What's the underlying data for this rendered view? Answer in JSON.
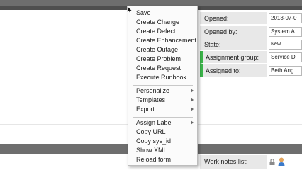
{
  "context_menu": {
    "items": [
      {
        "label": "Save",
        "submenu": false
      },
      {
        "label": "Create Change",
        "submenu": false
      },
      {
        "label": "Create Defect",
        "submenu": false
      },
      {
        "label": "Create Enhancement",
        "submenu": false
      },
      {
        "label": "Create Outage",
        "submenu": false
      },
      {
        "label": "Create Problem",
        "submenu": false
      },
      {
        "label": "Create Request",
        "submenu": false
      },
      {
        "label": "Execute Runbook",
        "submenu": false
      },
      {
        "label": "Personalize",
        "submenu": true
      },
      {
        "label": "Templates",
        "submenu": true
      },
      {
        "label": "Export",
        "submenu": true
      },
      {
        "label": "Assign Label",
        "submenu": true
      },
      {
        "label": "Copy URL",
        "submenu": false
      },
      {
        "label": "Copy sys_id",
        "submenu": false
      },
      {
        "label": "Show XML",
        "submenu": false
      },
      {
        "label": "Reload form",
        "submenu": false
      }
    ]
  },
  "form": {
    "fields": [
      {
        "label": "Opened:",
        "value": "2013-07-0",
        "mandatory": false
      },
      {
        "label": "Opened by:",
        "value": "System A",
        "mandatory": false
      },
      {
        "label": "State:",
        "value": "New",
        "mandatory": false
      },
      {
        "label": "Assignment group:",
        "value": "Service D",
        "mandatory": true
      },
      {
        "label": "Assigned to:",
        "value": "Beth Ang",
        "mandatory": true
      }
    ],
    "work_notes_label": "Work notes list:"
  },
  "icons": {
    "cursor": "mouse-pointer-icon",
    "lock": "lock-icon",
    "user": "user-icon",
    "submenu_arrow": "chevron-right-icon"
  },
  "colors": {
    "mandatory_indicator": "#3bb44a",
    "header_bar": "#6e6e6e",
    "label_background": "#e8e8e8"
  }
}
